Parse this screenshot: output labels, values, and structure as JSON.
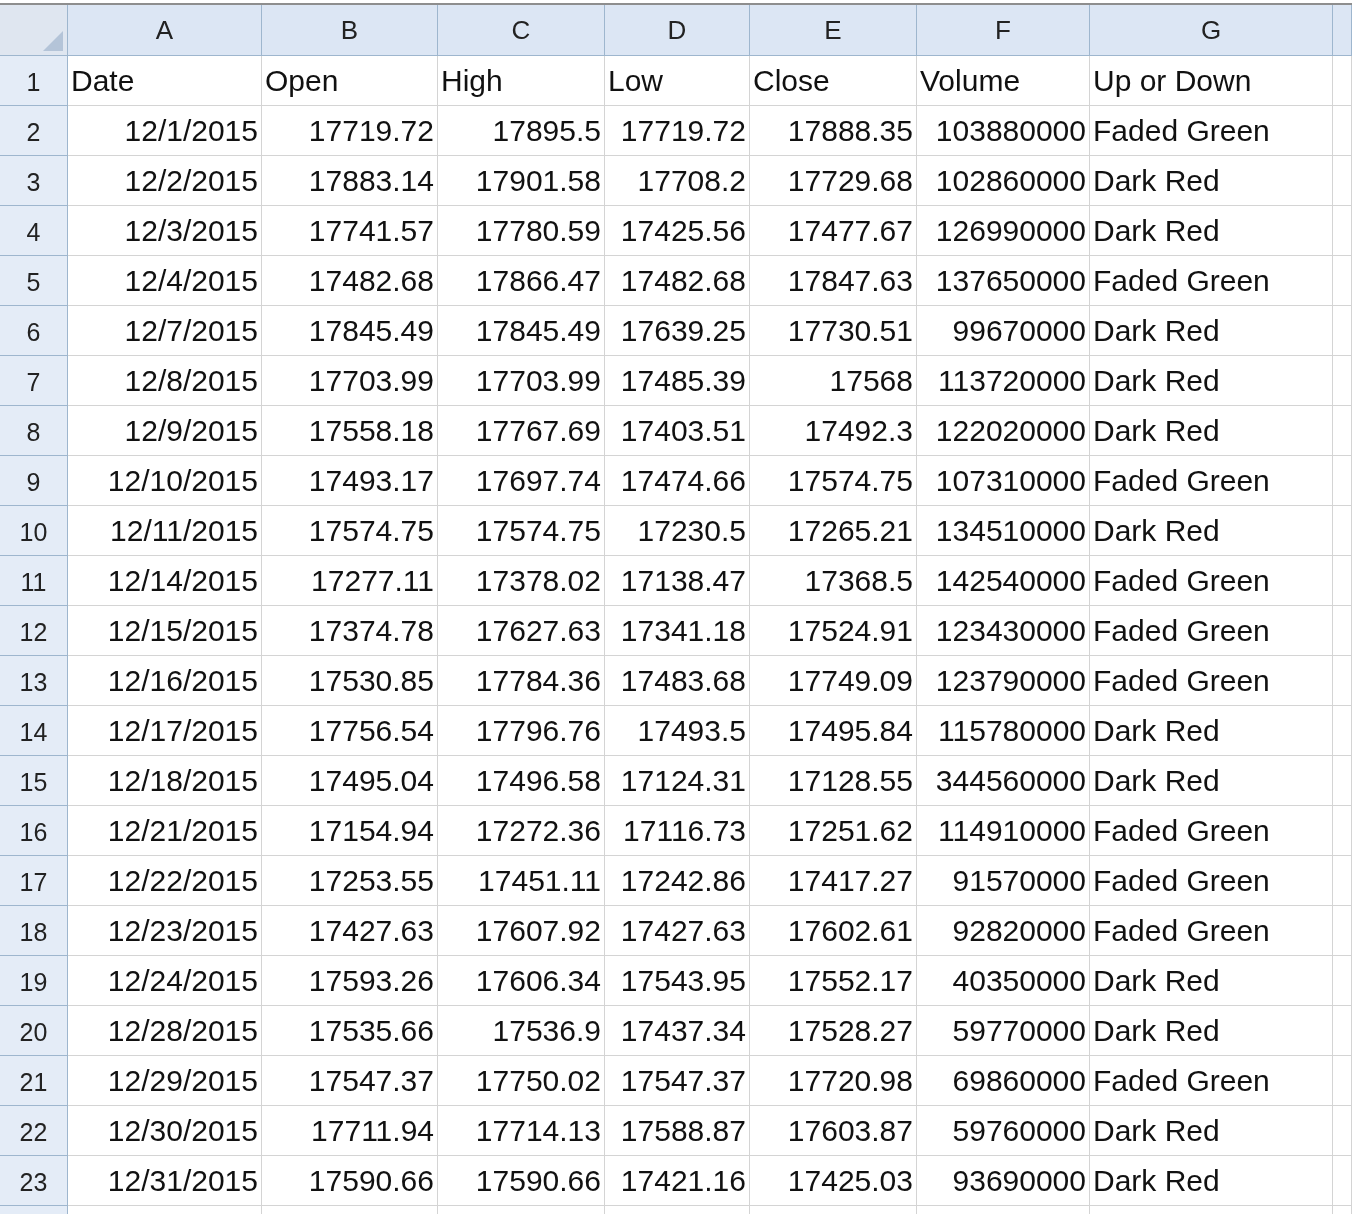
{
  "columns": [
    {
      "letter": "A",
      "kind": "number"
    },
    {
      "letter": "B",
      "kind": "number"
    },
    {
      "letter": "C",
      "kind": "number"
    },
    {
      "letter": "D",
      "kind": "number"
    },
    {
      "letter": "E",
      "kind": "number"
    },
    {
      "letter": "F",
      "kind": "number"
    },
    {
      "letter": "G",
      "kind": "text"
    }
  ],
  "rows": [
    {
      "number": "1",
      "kind": "header",
      "cells": [
        "Date",
        "Open",
        "High",
        "Low",
        "Close",
        "Volume",
        "Up or Down"
      ]
    },
    {
      "number": "2",
      "kind": "data",
      "cells": [
        "12/1/2015",
        "17719.72",
        "17895.5",
        "17719.72",
        "17888.35",
        "103880000",
        "Faded Green"
      ]
    },
    {
      "number": "3",
      "kind": "data",
      "cells": [
        "12/2/2015",
        "17883.14",
        "17901.58",
        "17708.2",
        "17729.68",
        "102860000",
        "Dark Red"
      ]
    },
    {
      "number": "4",
      "kind": "data",
      "cells": [
        "12/3/2015",
        "17741.57",
        "17780.59",
        "17425.56",
        "17477.67",
        "126990000",
        "Dark Red"
      ]
    },
    {
      "number": "5",
      "kind": "data",
      "cells": [
        "12/4/2015",
        "17482.68",
        "17866.47",
        "17482.68",
        "17847.63",
        "137650000",
        "Faded Green"
      ]
    },
    {
      "number": "6",
      "kind": "data",
      "cells": [
        "12/7/2015",
        "17845.49",
        "17845.49",
        "17639.25",
        "17730.51",
        "99670000",
        "Dark Red"
      ]
    },
    {
      "number": "7",
      "kind": "data",
      "cells": [
        "12/8/2015",
        "17703.99",
        "17703.99",
        "17485.39",
        "17568",
        "113720000",
        "Dark Red"
      ]
    },
    {
      "number": "8",
      "kind": "data",
      "cells": [
        "12/9/2015",
        "17558.18",
        "17767.69",
        "17403.51",
        "17492.3",
        "122020000",
        "Dark Red"
      ]
    },
    {
      "number": "9",
      "kind": "data",
      "cells": [
        "12/10/2015",
        "17493.17",
        "17697.74",
        "17474.66",
        "17574.75",
        "107310000",
        "Faded Green"
      ]
    },
    {
      "number": "10",
      "kind": "data",
      "cells": [
        "12/11/2015",
        "17574.75",
        "17574.75",
        "17230.5",
        "17265.21",
        "134510000",
        "Dark Red"
      ]
    },
    {
      "number": "11",
      "kind": "data",
      "cells": [
        "12/14/2015",
        "17277.11",
        "17378.02",
        "17138.47",
        "17368.5",
        "142540000",
        "Faded Green"
      ]
    },
    {
      "number": "12",
      "kind": "data",
      "cells": [
        "12/15/2015",
        "17374.78",
        "17627.63",
        "17341.18",
        "17524.91",
        "123430000",
        "Faded Green"
      ]
    },
    {
      "number": "13",
      "kind": "data",
      "cells": [
        "12/16/2015",
        "17530.85",
        "17784.36",
        "17483.68",
        "17749.09",
        "123790000",
        "Faded Green"
      ]
    },
    {
      "number": "14",
      "kind": "data",
      "cells": [
        "12/17/2015",
        "17756.54",
        "17796.76",
        "17493.5",
        "17495.84",
        "115780000",
        "Dark Red"
      ]
    },
    {
      "number": "15",
      "kind": "data",
      "cells": [
        "12/18/2015",
        "17495.04",
        "17496.58",
        "17124.31",
        "17128.55",
        "344560000",
        "Dark Red"
      ]
    },
    {
      "number": "16",
      "kind": "data",
      "cells": [
        "12/21/2015",
        "17154.94",
        "17272.36",
        "17116.73",
        "17251.62",
        "114910000",
        "Faded Green"
      ]
    },
    {
      "number": "17",
      "kind": "data",
      "cells": [
        "12/22/2015",
        "17253.55",
        "17451.11",
        "17242.86",
        "17417.27",
        "91570000",
        "Faded Green"
      ]
    },
    {
      "number": "18",
      "kind": "data",
      "cells": [
        "12/23/2015",
        "17427.63",
        "17607.92",
        "17427.63",
        "17602.61",
        "92820000",
        "Faded Green"
      ]
    },
    {
      "number": "19",
      "kind": "data",
      "cells": [
        "12/24/2015",
        "17593.26",
        "17606.34",
        "17543.95",
        "17552.17",
        "40350000",
        "Dark Red"
      ]
    },
    {
      "number": "20",
      "kind": "data",
      "cells": [
        "12/28/2015",
        "17535.66",
        "17536.9",
        "17437.34",
        "17528.27",
        "59770000",
        "Dark Red"
      ]
    },
    {
      "number": "21",
      "kind": "data",
      "cells": [
        "12/29/2015",
        "17547.37",
        "17750.02",
        "17547.37",
        "17720.98",
        "69860000",
        "Faded Green"
      ]
    },
    {
      "number": "22",
      "kind": "data",
      "cells": [
        "12/30/2015",
        "17711.94",
        "17714.13",
        "17588.87",
        "17603.87",
        "59760000",
        "Dark Red"
      ]
    },
    {
      "number": "23",
      "kind": "data",
      "cells": [
        "12/31/2015",
        "17590.66",
        "17590.66",
        "17421.16",
        "17425.03",
        "93690000",
        "Dark Red"
      ]
    }
  ]
}
